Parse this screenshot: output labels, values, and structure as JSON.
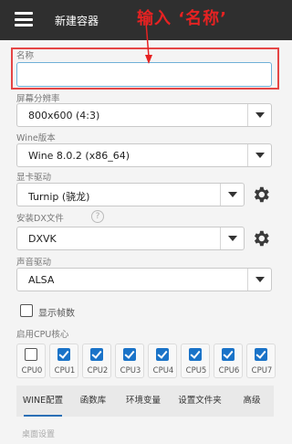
{
  "appbar": {
    "title": "新建容器",
    "menu_icon": "hamburger-menu-icon"
  },
  "annotation": {
    "text": "输入 ‘名称’",
    "color": "#e62222"
  },
  "form": {
    "name_label": "名称",
    "name_value": "",
    "resolution_label": "屏幕分辨率",
    "resolution_value": "800x600 (4:3)",
    "wine_label": "Wine版本",
    "wine_value": "Wine 8.0.2 (x86_64)",
    "gpu_label": "显卡驱动",
    "gpu_value": "Turnip (骁龙)",
    "dx_label": "安装DX文件",
    "dx_help": "?",
    "dx_value": "DXVK",
    "audio_label": "声音驱动",
    "audio_value": "ALSA",
    "fps_label": "显示帧数",
    "fps_checked": false,
    "cpu_label": "启用CPU核心",
    "cpus": [
      {
        "label": "CPU0",
        "checked": false
      },
      {
        "label": "CPU1",
        "checked": true
      },
      {
        "label": "CPU2",
        "checked": true
      },
      {
        "label": "CPU3",
        "checked": true
      },
      {
        "label": "CPU4",
        "checked": true
      },
      {
        "label": "CPU5",
        "checked": true
      },
      {
        "label": "CPU6",
        "checked": true
      },
      {
        "label": "CPU7",
        "checked": true
      }
    ]
  },
  "tabs": [
    "WINE配置",
    "函数库",
    "环境变量",
    "设置文件夹",
    "高级"
  ],
  "active_tab": 0,
  "section_hint": "桌面设置",
  "colors": {
    "accent": "#1a73c8",
    "appbar": "#2f2f2f",
    "highlight_box": "#e54545",
    "input_focus": "#6fb0d8"
  }
}
